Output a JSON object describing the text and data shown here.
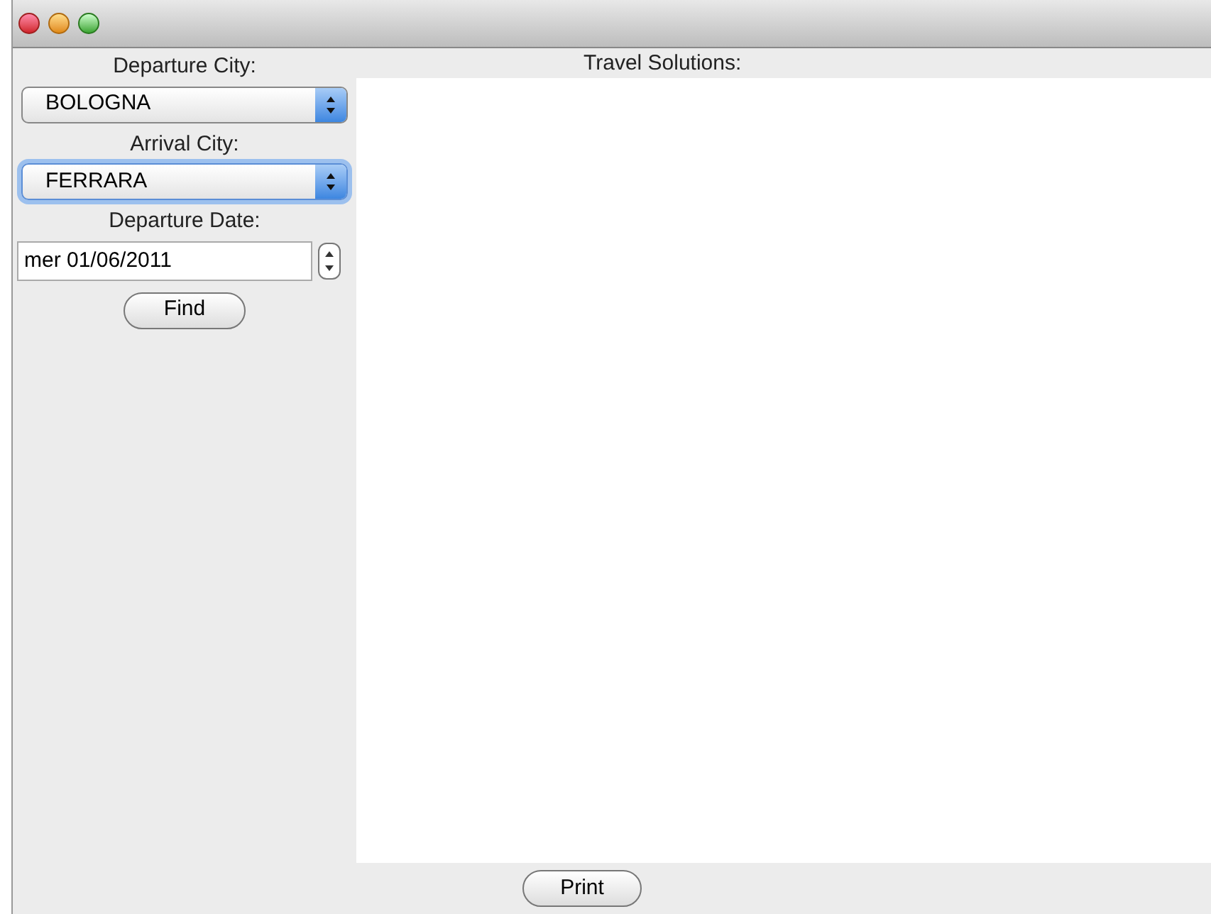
{
  "search_panel": {
    "departure_label": "Departure City:",
    "departure_city": {
      "value": "BOLOGNA",
      "focused": false
    },
    "arrival_label": "Arrival City:",
    "arrival_city": {
      "value": "FERRARA",
      "focused": true
    },
    "date_label": "Departure Date:",
    "departure_date": "mer 01/06/2011",
    "find_button": "Find"
  },
  "results": {
    "title": "Travel Solutions:"
  },
  "print_button": "Print"
}
